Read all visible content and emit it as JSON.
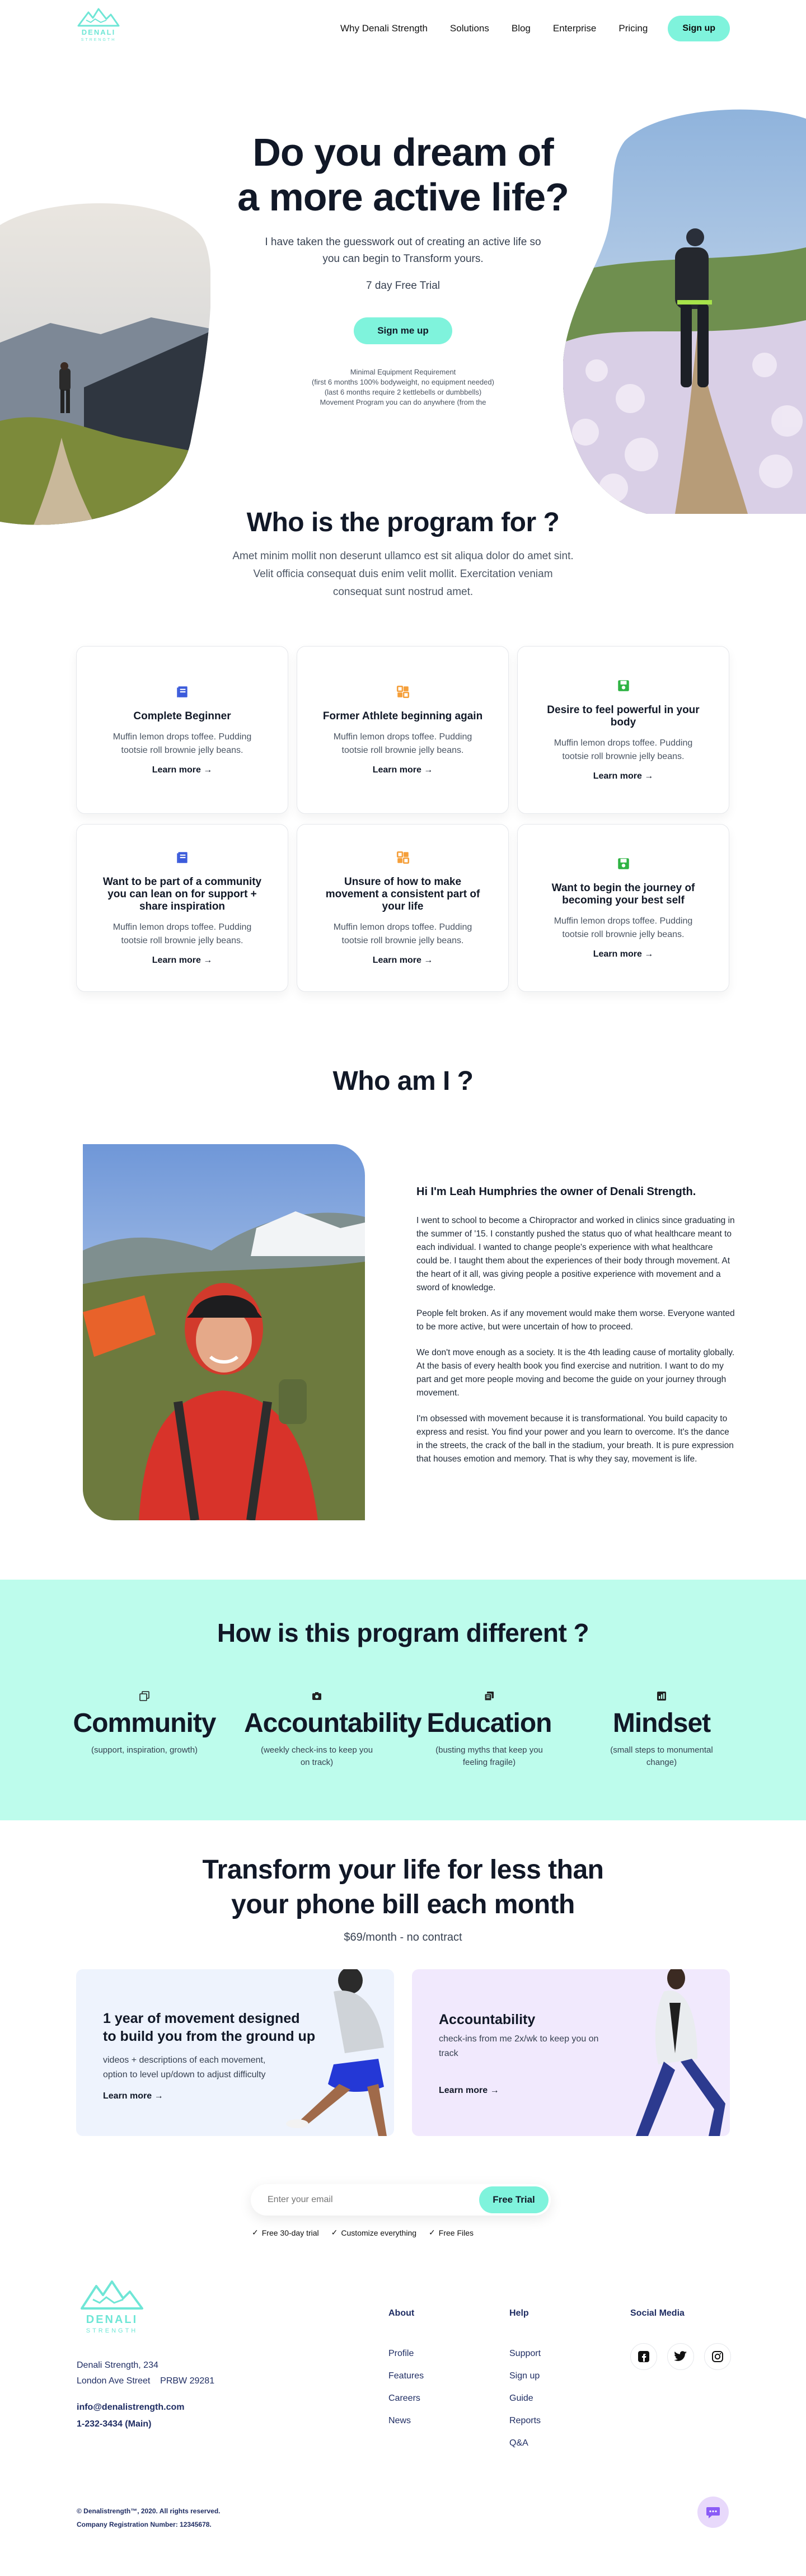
{
  "brand": {
    "name": "DENALI",
    "tagline": "STRENGTH",
    "accent": "#7ff3dc",
    "accent_light": "#bdfcec",
    "logo_color": "#6fe6d6"
  },
  "nav": {
    "links": [
      "Why Denali Strength",
      "Solutions",
      "Blog",
      "Enterprise",
      "Pricing"
    ],
    "signup_label": "Sign up"
  },
  "hero": {
    "title_line1": "Do you dream of",
    "title_line2": "a more active life?",
    "subtitle": "I have taken the guesswork out of creating an active life so you can begin to Transform yours.",
    "trial": "7 day Free Trial",
    "cta": "Sign me up",
    "requirements": [
      "Minimal Equipment Requirement",
      "(first 6 months 100% bodyweight, no equipment needed)",
      "(last 6 months require 2 kettlebells or dumbbells)",
      "Movement Program you can do anywhere (from the"
    ]
  },
  "who": {
    "title": "Who is the program for ?",
    "description": "Amet minim mollit non deserunt ullamco est sit aliqua dolor do amet sint. Velit officia consequat duis enim velit mollit. Exercitation veniam consequat sunt nostrud amet.",
    "cards": [
      {
        "title": "Complete Beginner",
        "text": "Muffin lemon drops toffee. Pudding tootsie roll brownie jelly beans.",
        "link": "Learn more →",
        "icon": "book-icon",
        "color": "#3b5bdb"
      },
      {
        "title": "Former Athlete beginning again",
        "text": "Muffin lemon drops toffee. Pudding tootsie roll brownie jelly beans.",
        "link": "Learn more →",
        "icon": "grid-icon",
        "color": "#f59f3a"
      },
      {
        "title": "Desire to feel powerful in your body",
        "text": "Muffin lemon drops toffee. Pudding tootsie roll brownie jelly beans.",
        "link": "Learn more →",
        "icon": "save-icon",
        "color": "#2fb344"
      },
      {
        "title": "Want to be part of a community you can lean on for support + share inspiration",
        "text": "Muffin lemon drops toffee. Pudding tootsie roll brownie jelly beans.",
        "link": "Learn more →",
        "icon": "book-icon",
        "color": "#3b5bdb"
      },
      {
        "title": "Unsure of how to make movement a consistent part of your life",
        "text": "Muffin lemon drops toffee. Pudding tootsie roll brownie jelly beans.",
        "link": "Learn more →",
        "icon": "grid-icon",
        "color": "#f59f3a"
      },
      {
        "title": "Want to begin the journey of becoming your best self",
        "text": "Muffin lemon drops toffee. Pudding tootsie roll brownie jelly beans.",
        "link": "Learn more →",
        "icon": "save-icon",
        "color": "#2fb344"
      }
    ]
  },
  "about": {
    "title": "Who am I ?",
    "heading": "Hi I'm Leah Humphries the owner of Denali Strength.",
    "paragraphs": [
      "I went to school to become a Chiropractor and worked in clinics since graduating in the summer of '15. I constantly pushed the status quo of what healthcare meant to each individual. I wanted to change people's experience with what healthcare could be. I taught them about the experiences of their body through movement. At the heart of it all, was giving people a positive experience with movement and a sword of knowledge.",
      "People felt broken. As if any movement would make them worse. Everyone wanted to be more active, but were uncertain of how to proceed.",
      "We don't move enough as a society. It is the 4th leading cause of mortality globally. At the basis of every health book you find exercise and nutrition. I want to do my part and get more people moving and become the guide on your journey through movement.",
      "I'm obsessed with movement because it is transformational. You build capacity to express and resist. You find your power and you learn to overcome. It's the dance in the streets, the crack of the ball in the stadium, your breath. It is pure expression that houses emotion and memory. That is why they say, movement is life."
    ]
  },
  "different": {
    "title": "How is this program different ?",
    "pillars": [
      {
        "name": "Community",
        "desc": "(support, inspiration, growth)",
        "icon": "copy-icon"
      },
      {
        "name": "Accountability",
        "desc": "(weekly check-ins to keep you on track)",
        "icon": "camera-icon"
      },
      {
        "name": "Education",
        "desc": "(busting myths that keep you feeling fragile)",
        "icon": "book-stack-icon"
      },
      {
        "name": "Mindset",
        "desc": "(small steps to monumental change)",
        "icon": "chart-icon"
      }
    ]
  },
  "pricing": {
    "title_line1": "Transform your life for less than",
    "title_line2": "your phone bill each month",
    "price": "$69/month - no contract",
    "cards": [
      {
        "title": "1 year of movement designed to build you from the ground up",
        "desc": "videos + descriptions of each movement, option to level up/down to adjust difficulty",
        "link": "Learn more →"
      },
      {
        "title": "Accountability",
        "desc": "check-ins from me 2x/wk to keep you on track",
        "link": "Learn more →"
      }
    ]
  },
  "signup": {
    "placeholder": "Enter your email",
    "button": "Free Trial",
    "checks": [
      "Free 30-day trial",
      "Customize everything",
      "Free Files"
    ]
  },
  "footer": {
    "address_line1": "Denali Strength, 234",
    "address_line2": "London Ave Street",
    "postcode": "PRBW 29281",
    "email": "info@denalistrength.com",
    "phone": "1-232-3434 (Main)",
    "columns": [
      {
        "title": "About",
        "links": [
          "Profile",
          "Features",
          "Careers",
          "News"
        ]
      },
      {
        "title": "Help",
        "links": [
          "Support",
          "Sign up",
          "Guide",
          "Reports",
          "Q&A"
        ]
      }
    ],
    "social_title": "Social Media",
    "social": [
      "facebook-icon",
      "twitter-icon",
      "instagram-icon"
    ],
    "copyright": "© Denalistrength™, 2020. All rights reserved.",
    "registration": "Company Registration Number: 12345678."
  }
}
